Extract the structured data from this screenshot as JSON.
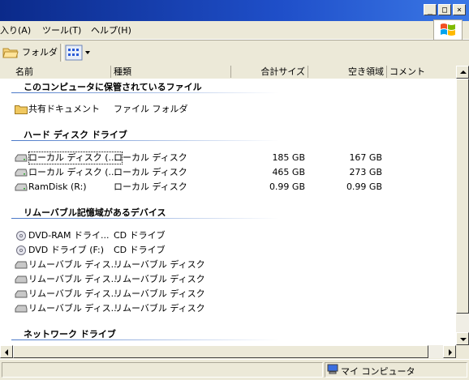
{
  "menubar": {
    "items": [
      {
        "label": "入り(A)"
      },
      {
        "label": "ツール(T)"
      },
      {
        "label": "ヘルプ(H)"
      }
    ]
  },
  "toolbar": {
    "folders_label": "フォルダ"
  },
  "columns": {
    "name": "名前",
    "type": "種類",
    "total": "合計サイズ",
    "free": "空き領域",
    "comment": "コメント"
  },
  "groups": {
    "stored_files": {
      "title": "このコンピュータに保管されているファイル",
      "items": [
        {
          "name": "共有ドキュメント",
          "type": "ファイル フォルダ",
          "icon": "folder-icon"
        }
      ]
    },
    "hard_disks": {
      "title": "ハード ディスク ドライブ",
      "items": [
        {
          "name": "ローカル ディスク (...",
          "type": "ローカル ディスク",
          "total": "185 GB",
          "free": "167 GB",
          "icon": "hard-disk-icon"
        },
        {
          "name": "ローカル ディスク (...",
          "type": "ローカル ディスク",
          "total": "465 GB",
          "free": "273 GB",
          "icon": "hard-disk-icon"
        },
        {
          "name": "RamDisk (R:)",
          "type": "ローカル ディスク",
          "total": "0.99 GB",
          "free": "0.99 GB",
          "icon": "hard-disk-icon"
        }
      ]
    },
    "removable": {
      "title": "リムーバブル記憶域があるデバイス",
      "items": [
        {
          "name": "DVD-RAM ドライ...",
          "type": "CD ドライブ",
          "icon": "optical-drive-icon"
        },
        {
          "name": "DVD ドライブ (F:)",
          "type": "CD ドライブ",
          "icon": "optical-drive-icon"
        },
        {
          "name": "リムーバブル ディス...",
          "type": "リムーバブル ディスク",
          "icon": "removable-disk-icon"
        },
        {
          "name": "リムーバブル ディス...",
          "type": "リムーバブル ディスク",
          "icon": "removable-disk-icon"
        },
        {
          "name": "リムーバブル ディス...",
          "type": "リムーバブル ディスク",
          "icon": "removable-disk-icon"
        },
        {
          "name": "リムーバブル ディス...",
          "type": "リムーバブル ディスク",
          "icon": "removable-disk-icon"
        }
      ]
    },
    "network": {
      "title": "ネットワーク ドライブ"
    }
  },
  "statusbar": {
    "location": "マイ コンピュータ"
  },
  "colors": {
    "titlebar": "#1f4fc9",
    "window_bg": "#ece9d8",
    "list_bg": "#ffffff",
    "group_line": "#4a78c8"
  }
}
